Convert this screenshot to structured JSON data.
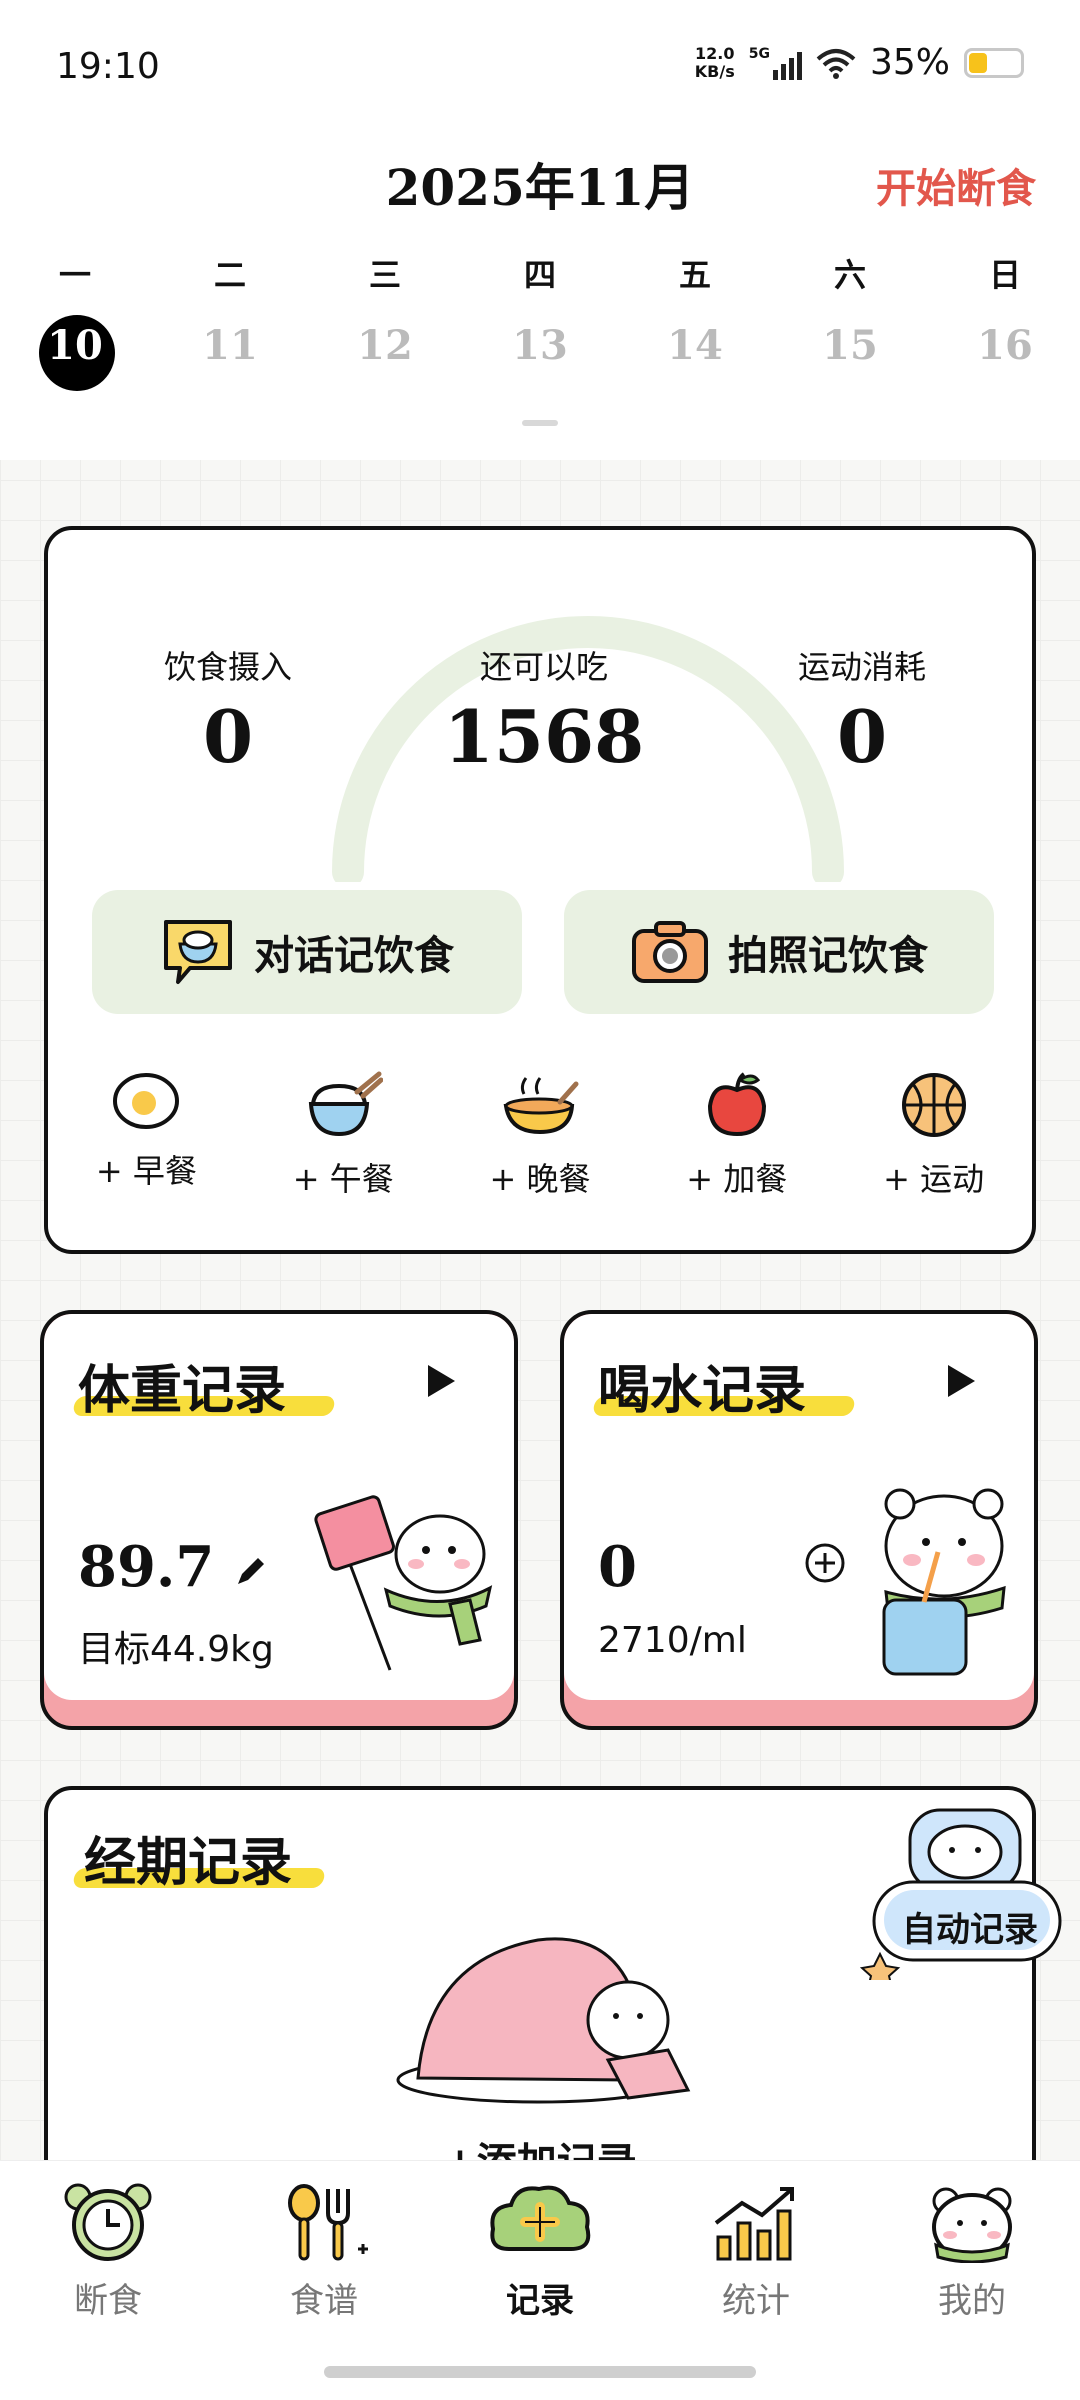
{
  "status": {
    "time": "19:10",
    "net_speed_value": "12.0",
    "net_speed_unit": "KB/s",
    "network": "5G",
    "battery": "35%",
    "battery_level": 0.35
  },
  "header": {
    "month": "2025年11月",
    "start_fast": "开始断食"
  },
  "week": {
    "days": [
      "一",
      "二",
      "三",
      "四",
      "五",
      "六",
      "日"
    ],
    "dates": [
      "10",
      "11",
      "12",
      "13",
      "14",
      "15",
      "16"
    ],
    "selected_index": 0
  },
  "intake": {
    "intake_label": "饮食摄入",
    "intake_value": "0",
    "remain_label": "还可以吃",
    "remain_value": "1568",
    "burn_label": "运动消耗",
    "burn_value": "0",
    "chat_button": "对话记饮食",
    "photo_button": "拍照记饮食",
    "meals": [
      "+ 早餐",
      "+ 午餐",
      "+ 晚餐",
      "+ 加餐",
      "+ 运动"
    ]
  },
  "weight": {
    "title": "体重记录",
    "value": "89.7",
    "target": "目标44.9kg"
  },
  "water": {
    "title": "喝水记录",
    "value": "0",
    "target": "2710/ml"
  },
  "period": {
    "title": "经期记录",
    "auto_badge": "自动记录",
    "add": "+添加记录"
  },
  "nav": {
    "tabs": [
      "断食",
      "食谱",
      "记录",
      "统计",
      "我的"
    ],
    "active_index": 2
  },
  "colors": {
    "accent": "#e2574c",
    "card_green": "#e9f1e2",
    "pink": "#f4a3a8",
    "highlight": "#f8de3c"
  }
}
